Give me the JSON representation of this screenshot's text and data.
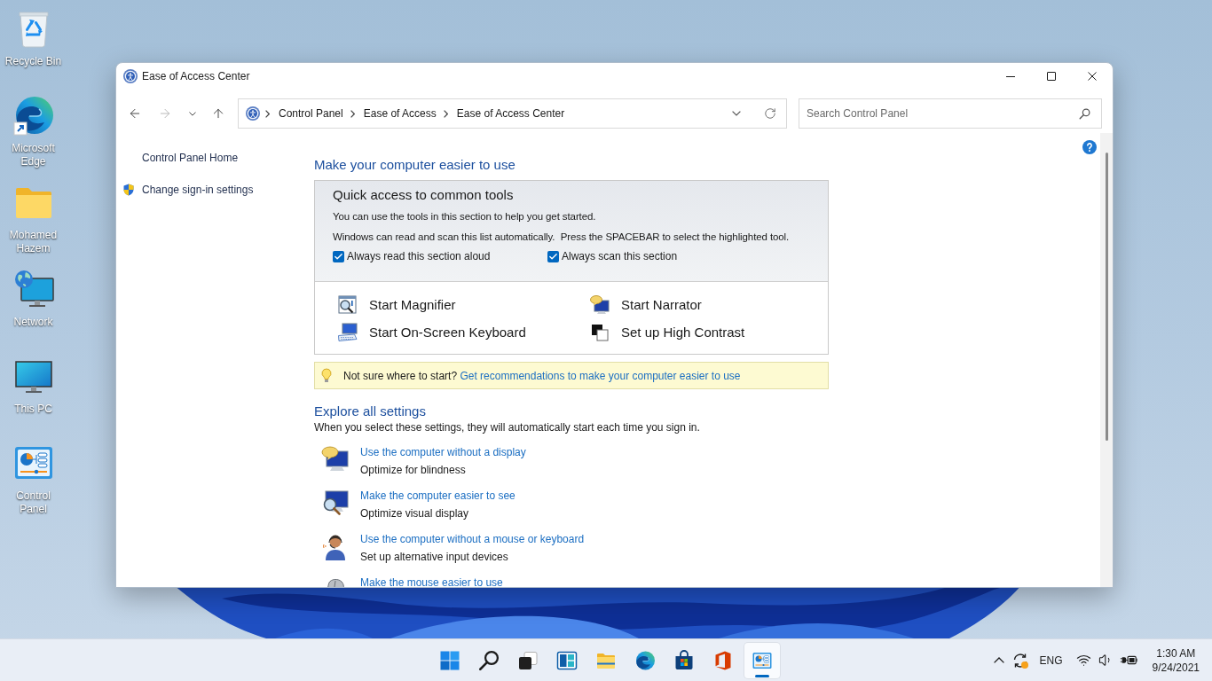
{
  "desktop_icons": [
    {
      "label": "Recycle Bin",
      "kind": "recycle-bin"
    },
    {
      "label": "Microsoft Edge",
      "kind": "edge"
    },
    {
      "label": "Mohamed Hazem",
      "kind": "folder"
    },
    {
      "label": "Network",
      "kind": "network"
    },
    {
      "label": "This PC",
      "kind": "pc"
    },
    {
      "label": "Control Panel",
      "kind": "control-panel"
    }
  ],
  "window": {
    "title": "Ease of Access Center"
  },
  "navigation": [
    {
      "kind": "back",
      "disabled": false
    },
    {
      "kind": "forward",
      "disabled": true
    },
    {
      "kind": "recent",
      "disabled": false
    },
    {
      "kind": "up",
      "disabled": false
    }
  ],
  "address_bar": {
    "breadcrumbs": [
      "Control Panel",
      "Ease of Access",
      "Ease of Access Center"
    ]
  },
  "search": {
    "placeholder": "Search Control Panel"
  },
  "sidebar": {
    "items": [
      {
        "label": "Control Panel Home",
        "kind": "plain"
      },
      {
        "label": "Change sign-in settings",
        "kind": "admin"
      }
    ]
  },
  "main": {
    "heading": "Make your computer easier to use",
    "quick_access": {
      "title": "Quick access to common tools",
      "lines": [
        "You can use the tools in this section to help you get started.",
        "Windows can read and scan this list automatically.  Press the SPACEBAR to select the highlighted tool."
      ],
      "options": [
        {
          "label": "Always read this section aloud",
          "checked": true
        },
        {
          "label": "Always scan this section",
          "checked": true
        }
      ],
      "tools": [
        {
          "label": "Start Magnifier",
          "kind": "magnifier"
        },
        {
          "label": "Start Narrator",
          "kind": "narrator"
        },
        {
          "label": "Start On-Screen Keyboard",
          "kind": "keyboard"
        },
        {
          "label": "Set up High Contrast",
          "kind": "contrast"
        }
      ]
    },
    "tip": {
      "text": "Not sure where to start?",
      "link": "Get recommendations to make your computer easier to use"
    },
    "explore": {
      "heading": "Explore all settings",
      "intro": "When you select these settings, they will automatically start each time you sign in.",
      "items": [
        {
          "link": "Use the computer without a display",
          "description": "Optimize for blindness",
          "kind": "display"
        },
        {
          "link": "Make the computer easier to see",
          "description": "Optimize visual display",
          "kind": "see"
        },
        {
          "link": "Use the computer without a mouse or keyboard",
          "description": "Set up alternative input devices",
          "kind": "input"
        },
        {
          "link": "Make the mouse easier to use",
          "kind": "mouse"
        }
      ]
    }
  },
  "taskbar": {
    "apps": [
      {
        "kind": "start",
        "selected": false
      },
      {
        "kind": "search",
        "selected": false
      },
      {
        "kind": "task-view",
        "selected": false
      },
      {
        "kind": "widgets",
        "selected": false
      },
      {
        "kind": "explorer",
        "selected": false
      },
      {
        "kind": "edge",
        "selected": false
      },
      {
        "kind": "store",
        "selected": false
      },
      {
        "kind": "office",
        "selected": false
      },
      {
        "kind": "control-panel",
        "selected": true
      }
    ],
    "tray": {
      "language": "ENG",
      "time": "1:30 AM",
      "date": "9/24/2021"
    }
  }
}
